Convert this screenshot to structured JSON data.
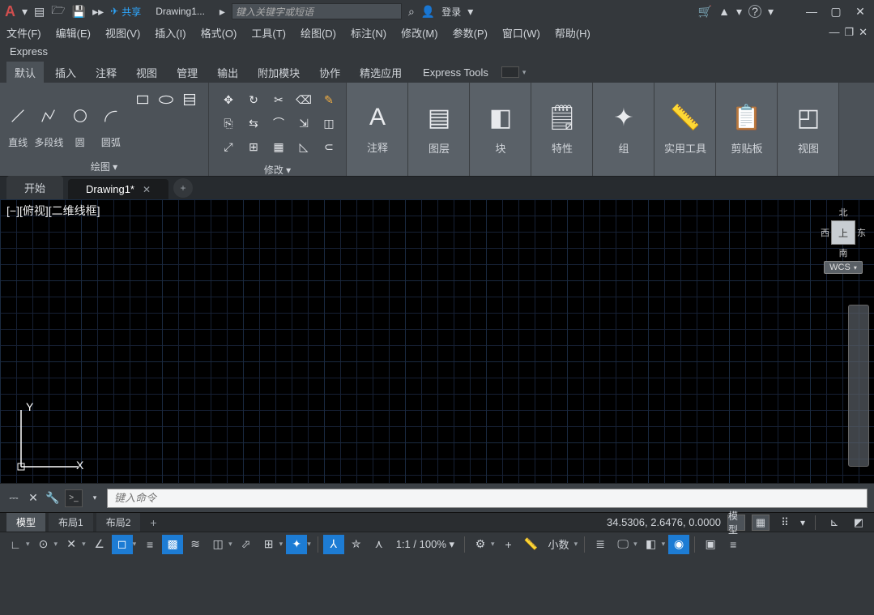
{
  "titlebar": {
    "share": "共享",
    "document": "Drawing1...",
    "search_placeholder": "键入关键字或短语",
    "login": "登录",
    "search_icon_sym": "⌕",
    "user_icon_sym": "👤",
    "cart_icon_sym": "🛒",
    "app_icon_sym": "▲",
    "help_icon_sym": "?"
  },
  "menus": {
    "file": "文件(F)",
    "edit": "编辑(E)",
    "view": "视图(V)",
    "insert": "插入(I)",
    "format": "格式(O)",
    "tools": "工具(T)",
    "draw": "绘图(D)",
    "dimension": "标注(N)",
    "modify": "修改(M)",
    "parametric": "参数(P)",
    "window": "窗口(W)",
    "help": "帮助(H)"
  },
  "expressbar": "Express",
  "ribbon_tabs": {
    "default": "默认",
    "insert": "插入",
    "annotate": "注释",
    "view": "视图",
    "manage": "管理",
    "output": "输出",
    "addins": "附加模块",
    "collab": "协作",
    "featured": "精选应用",
    "express": "Express Tools"
  },
  "ribbon_draw": {
    "line": "直线",
    "polyline": "多段线",
    "circle": "圆",
    "arc": "圆弧",
    "panel": "绘图 ▾"
  },
  "ribbon_mod": {
    "panel": "修改 ▾"
  },
  "ribbon_panels": {
    "annotate": "注释",
    "layer": "图层",
    "block": "块",
    "props": "特性",
    "group": "组",
    "utils": "实用工具",
    "clip": "剪贴板",
    "view": "视图"
  },
  "file_tabs": {
    "start": "开始",
    "drawing": "Drawing1*"
  },
  "viewport_label": "[−][俯视][二维线框]",
  "viewcube": {
    "n": "北",
    "s": "南",
    "e": "东",
    "w": "西",
    "top": "上",
    "wcs": "WCS"
  },
  "cmd_placeholder": "键入命令",
  "layout_tabs": {
    "model": "模型",
    "layout1": "布局1",
    "layout2": "布局2"
  },
  "coords": "34.5306, 2.6476, 0.0000",
  "model_btn": "模型",
  "scale_txt": "1:1 / 100% ▾",
  "unit_txt": "小数",
  "ucs_y": "Y",
  "ucs_x": "X"
}
